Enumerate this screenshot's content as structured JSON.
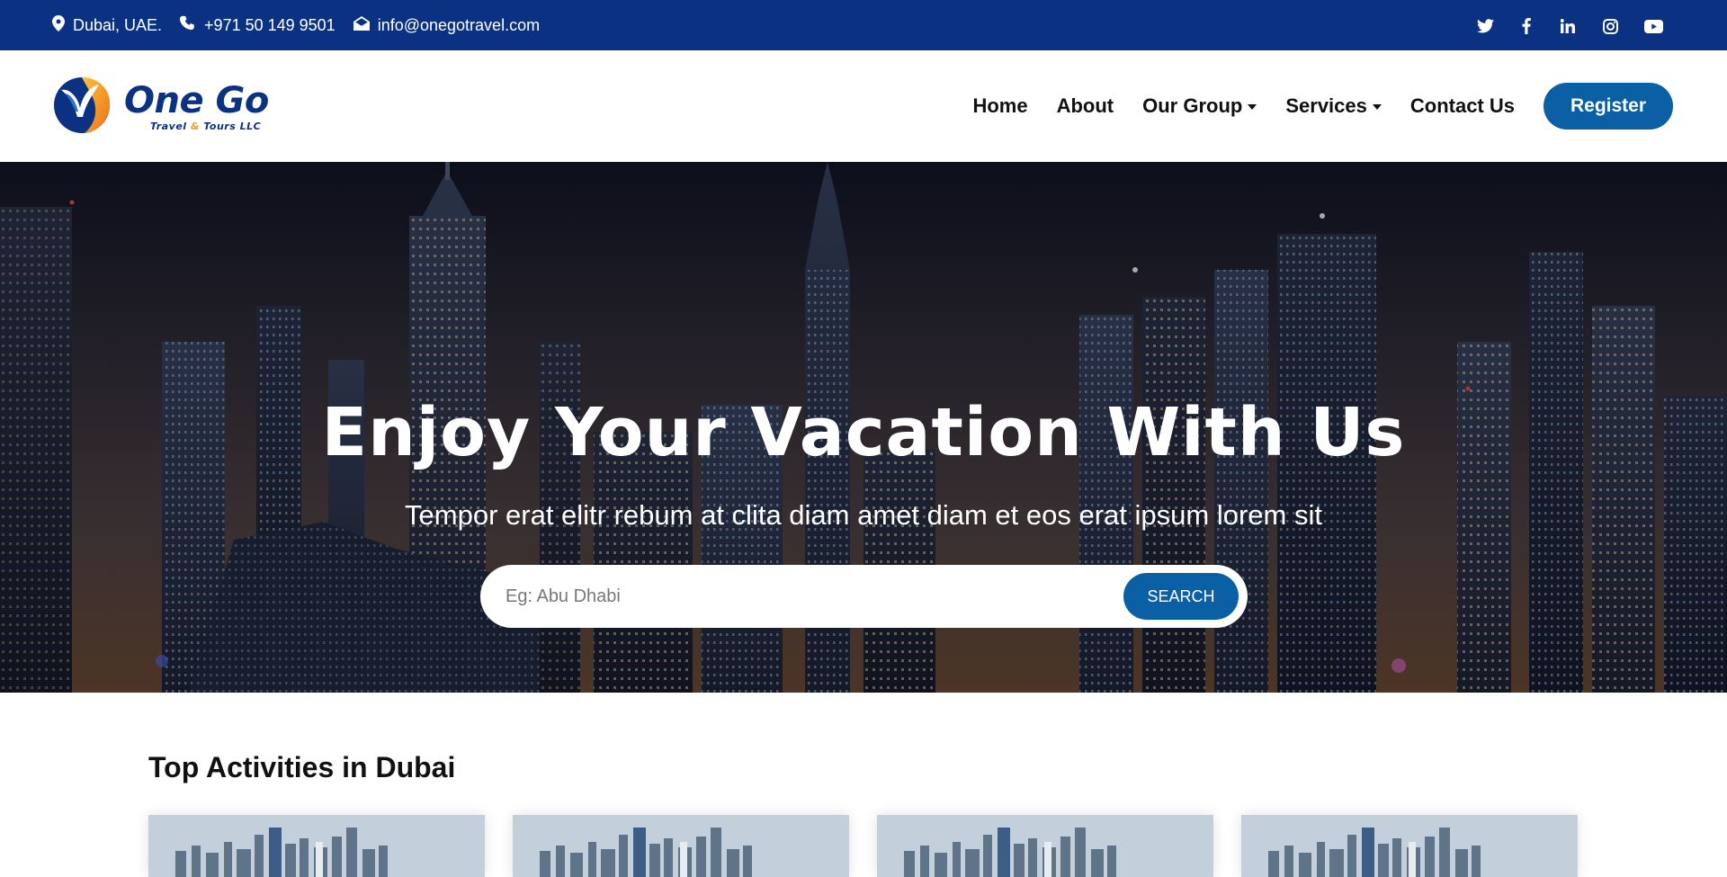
{
  "topbar": {
    "location": "Dubai, UAE.",
    "phone": "+971 50 149 9501",
    "email": "info@onegotravel.com",
    "social": [
      "twitter-icon",
      "facebook-icon",
      "linkedin-icon",
      "instagram-icon",
      "youtube-icon"
    ]
  },
  "brand": {
    "name": "One Go",
    "tagline_a": "Travel",
    "tagline_amp": "&",
    "tagline_b": "Tours LLC"
  },
  "nav": {
    "home": "Home",
    "about": "About",
    "our_group": "Our Group",
    "services": "Services",
    "contact": "Contact Us",
    "register": "Register"
  },
  "hero": {
    "title": "Enjoy Your Vacation With Us",
    "subtitle": "Tempor erat elitr rebum at clita diam amet diam et eos erat ipsum lorem sit",
    "search_placeholder": "Eg: Abu Dhabi",
    "search_button": "SEARCH"
  },
  "activities": {
    "title": "Top Activities in Dubai",
    "card_count": 4
  },
  "colors": {
    "topbar": "#0b3282",
    "primary_button": "#0b5fa4",
    "brand_orange": "#f29a1f"
  }
}
